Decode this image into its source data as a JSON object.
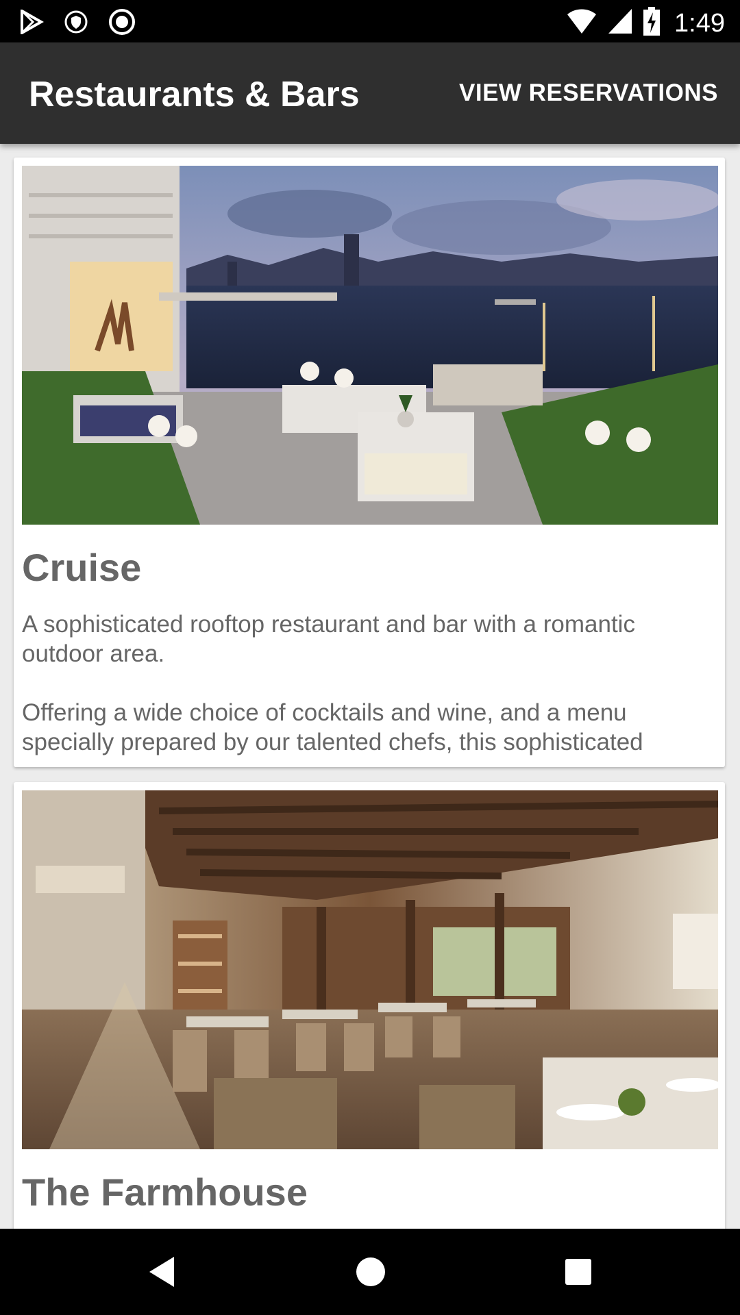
{
  "status_bar": {
    "time": "1:49",
    "left_icons": [
      "play-store-icon",
      "shield-icon",
      "record-icon"
    ],
    "right_icons": [
      "wifi-icon",
      "signal-icon",
      "battery-charging-icon"
    ]
  },
  "app_bar": {
    "title": "Restaurants & Bars",
    "action_label": "VIEW RESERVATIONS"
  },
  "restaurants": [
    {
      "name": "Cruise",
      "image_icon": "rooftop-terrace-photo",
      "description_1": "A sophisticated rooftop restaurant and bar with a romantic outdoor area.",
      "description_2": "Offering a wide choice of cocktails and wine, and a menu specially prepared by our talented chefs, this sophisticated"
    },
    {
      "name": "The Farmhouse",
      "image_icon": "dining-room-photo"
    }
  ],
  "nav_bar": {
    "buttons": [
      "back-icon",
      "home-icon",
      "recents-icon"
    ]
  }
}
